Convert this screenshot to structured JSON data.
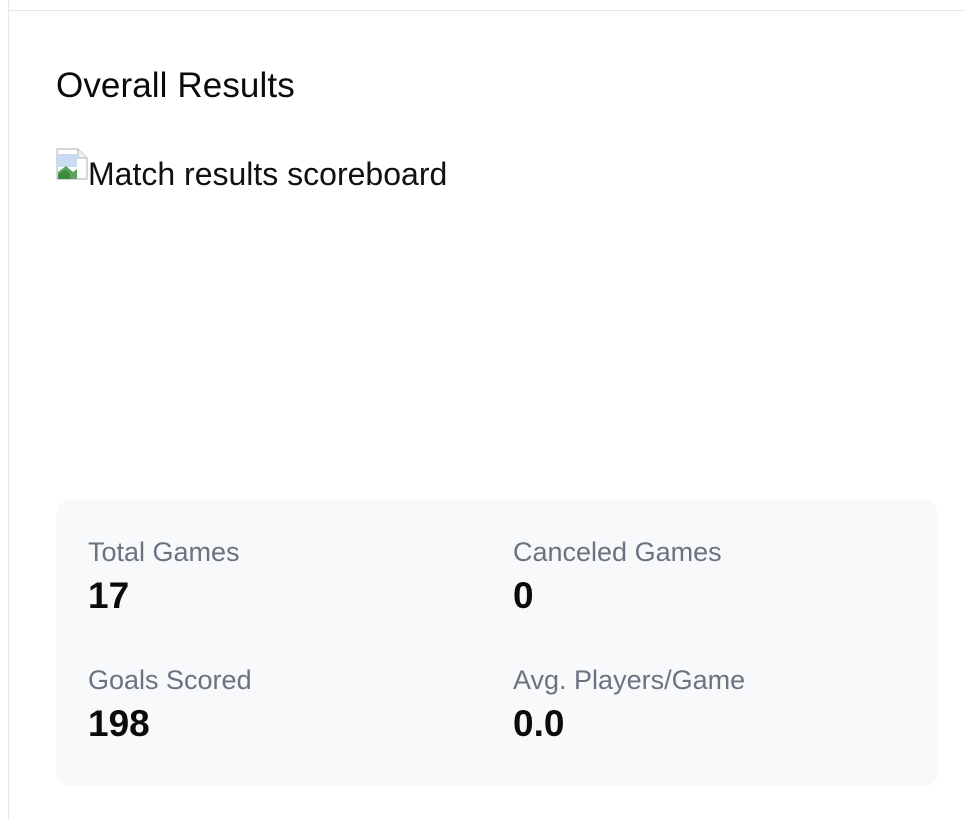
{
  "section": {
    "title": "Overall Results"
  },
  "image": {
    "alt": "Match results scoreboard",
    "icon": "broken-image-icon"
  },
  "stats": {
    "total_games": {
      "label": "Total Games",
      "value": "17"
    },
    "canceled_games": {
      "label": "Canceled Games",
      "value": "0"
    },
    "goals_scored": {
      "label": "Goals Scored",
      "value": "198"
    },
    "avg_players": {
      "label": "Avg. Players/Game",
      "value": "0.0"
    }
  },
  "colors": {
    "card_background": "#f8f9fb",
    "label_gray": "#6b7280",
    "text_dark": "#0b0b0b",
    "border": "#e5e7eb"
  }
}
